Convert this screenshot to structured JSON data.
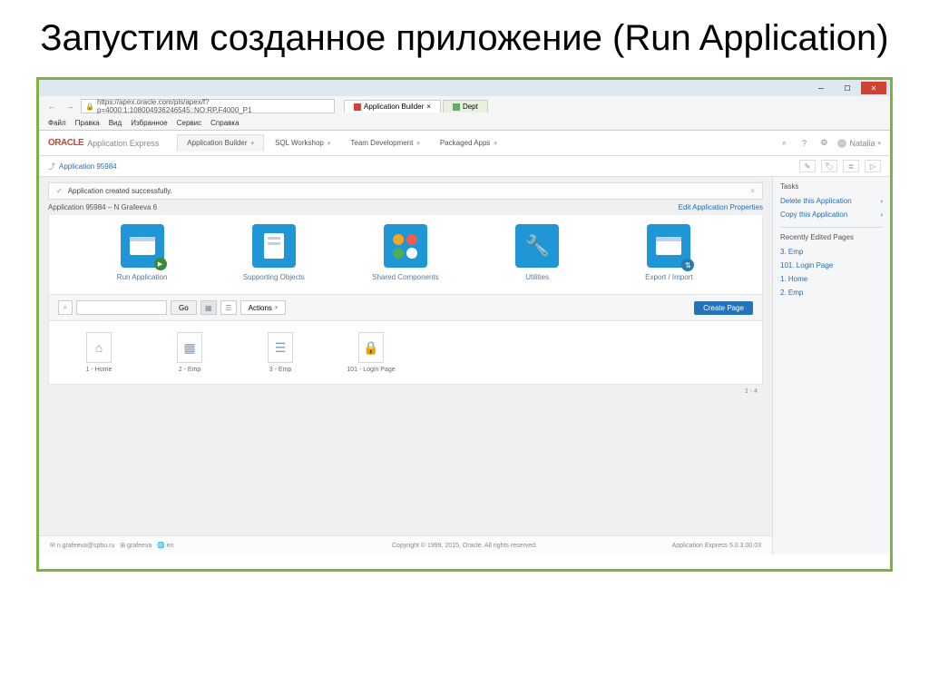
{
  "slide_title": "Запустим созданное приложение (Run Application)",
  "browser": {
    "url": "https://apex.oracle.com/pls/apex/f?p=4000:1:108004936246545::NO:RP,F4000_P1",
    "tabs": [
      {
        "label": "Application Builder",
        "active": true
      },
      {
        "label": "Dept",
        "active": false
      }
    ],
    "menu": [
      "Файл",
      "Правка",
      "Вид",
      "Избранное",
      "Сервис",
      "Справка"
    ]
  },
  "oracle": {
    "logo": "ORACLE",
    "product": "Application Express",
    "tabs": [
      {
        "label": "Application Builder",
        "active": true
      },
      {
        "label": "SQL Workshop"
      },
      {
        "label": "Team Development"
      },
      {
        "label": "Packaged Apps"
      }
    ],
    "user": "Natalia"
  },
  "breadcrumb": "Application 95984",
  "success_msg": "Application created successfully.",
  "app_title": "Application 95984 – N Grafeeva 6",
  "edit_link": "Edit Application Properties",
  "tiles": [
    {
      "label": "Run Application",
      "kind": "run"
    },
    {
      "label": "Supporting Objects",
      "kind": "support"
    },
    {
      "label": "Shared Components",
      "kind": "shared"
    },
    {
      "label": "Utilities",
      "kind": "wrench"
    },
    {
      "label": "Export / Import",
      "kind": "export"
    }
  ],
  "search": {
    "go": "Go",
    "actions": "Actions",
    "create_page": "Create Page"
  },
  "pages": [
    {
      "label": "1 - Home",
      "icon": "home"
    },
    {
      "label": "2 - Emp",
      "icon": "grid"
    },
    {
      "label": "3 - Emp",
      "icon": "form"
    },
    {
      "label": "101 - Login Page",
      "icon": "lock"
    }
  ],
  "pages_count": "1 - 4",
  "footer": {
    "left_user": "n.grafeeva@spbu.ru",
    "left_ws": "grafeeva",
    "left_lang": "en",
    "center": "Copyright © 1999, 2015, Oracle. All rights reserved.",
    "right": "Application Express 5.0.3.00.03"
  },
  "sidebar": {
    "tasks_title": "Tasks",
    "tasks": [
      "Delete this Application",
      "Copy this Application"
    ],
    "recent_title": "Recently Edited Pages",
    "recent": [
      "3. Emp",
      "101. Login Page",
      "1. Home",
      "2. Emp"
    ]
  }
}
